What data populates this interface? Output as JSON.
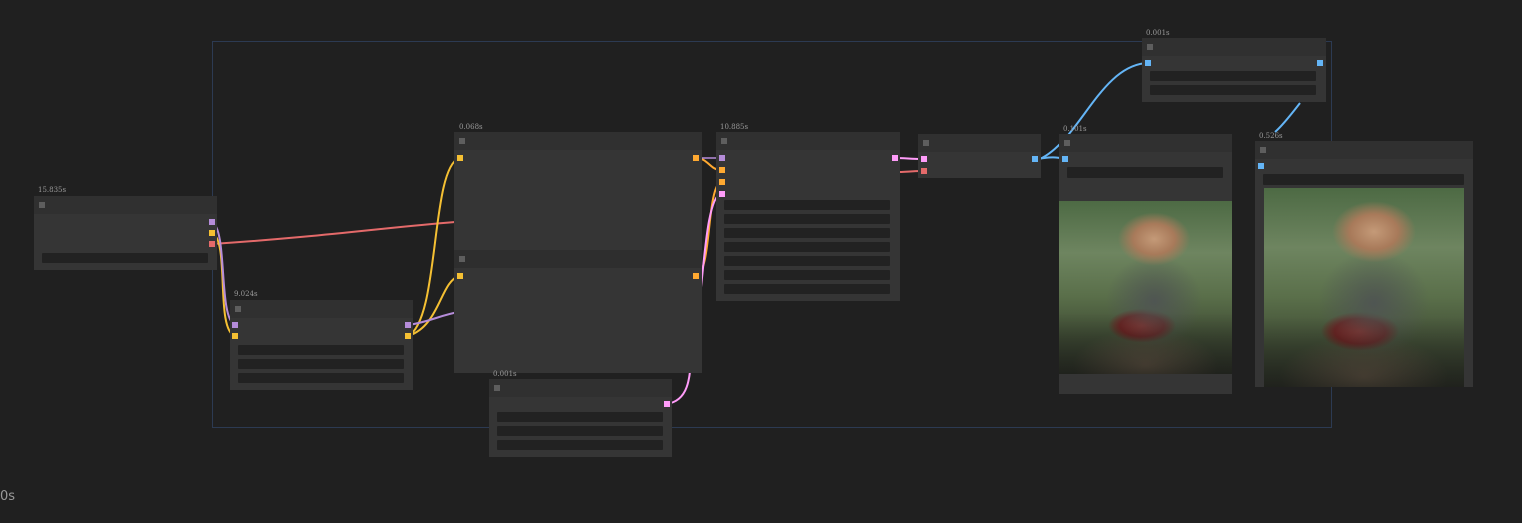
{
  "canvas": {
    "footer_time": "0s"
  },
  "nodes": {
    "n_left": {
      "timing": "15.835s"
    },
    "n_mid_left": {
      "timing": "9.024s"
    },
    "n_center": {
      "timing": "0.068s"
    },
    "n_small": {
      "timing": "0.001s"
    },
    "n_sampler": {
      "timing": "10.885s"
    },
    "n_decode": {
      "timing": ""
    },
    "n_preview": {
      "timing": "0.101s"
    },
    "n_top_right": {
      "timing": "0.001s"
    },
    "n_save": {
      "timing": "0.526s"
    }
  },
  "colors": {
    "clip": "#b58cd9",
    "model": "#f5c033",
    "vae": "#e46a6a",
    "latent": "#ff9cf9",
    "image": "#64b5f6",
    "conditioning": "#ffa931"
  },
  "images": {
    "preview_alt": "man-riding-motorcycle-image",
    "save_alt": "man-riding-motorcycle-image"
  }
}
